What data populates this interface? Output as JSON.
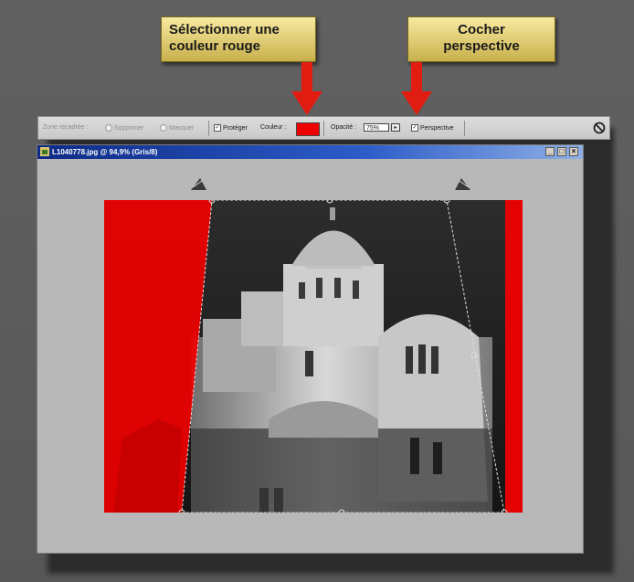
{
  "callouts": {
    "select_color_line1": "Sélectionner une",
    "select_color_line2": "couleur rouge",
    "check_perspective_line1": "Cocher",
    "check_perspective_line2": "perspective"
  },
  "toolbar": {
    "crop_zone_label": "Zone recadrée :",
    "delete_label": "Supprimer",
    "hide_label": "Masquer",
    "protect_label": "Protéger",
    "color_label": "Couleur :",
    "opacity_label": "Opacité :",
    "opacity_value": "75%",
    "perspective_label": "Perspective",
    "colors": {
      "shield_color": "#ee0000"
    }
  },
  "document": {
    "title": "L1040778.jpg @ 94,9% (Gris/8)"
  },
  "icons": {
    "cancel": "cancel-icon",
    "minimize": "minimize-icon",
    "maximize": "maximize-icon",
    "close": "close-icon"
  },
  "colors": {
    "arrow": "#e11d12",
    "callout": "#e7d27a"
  }
}
